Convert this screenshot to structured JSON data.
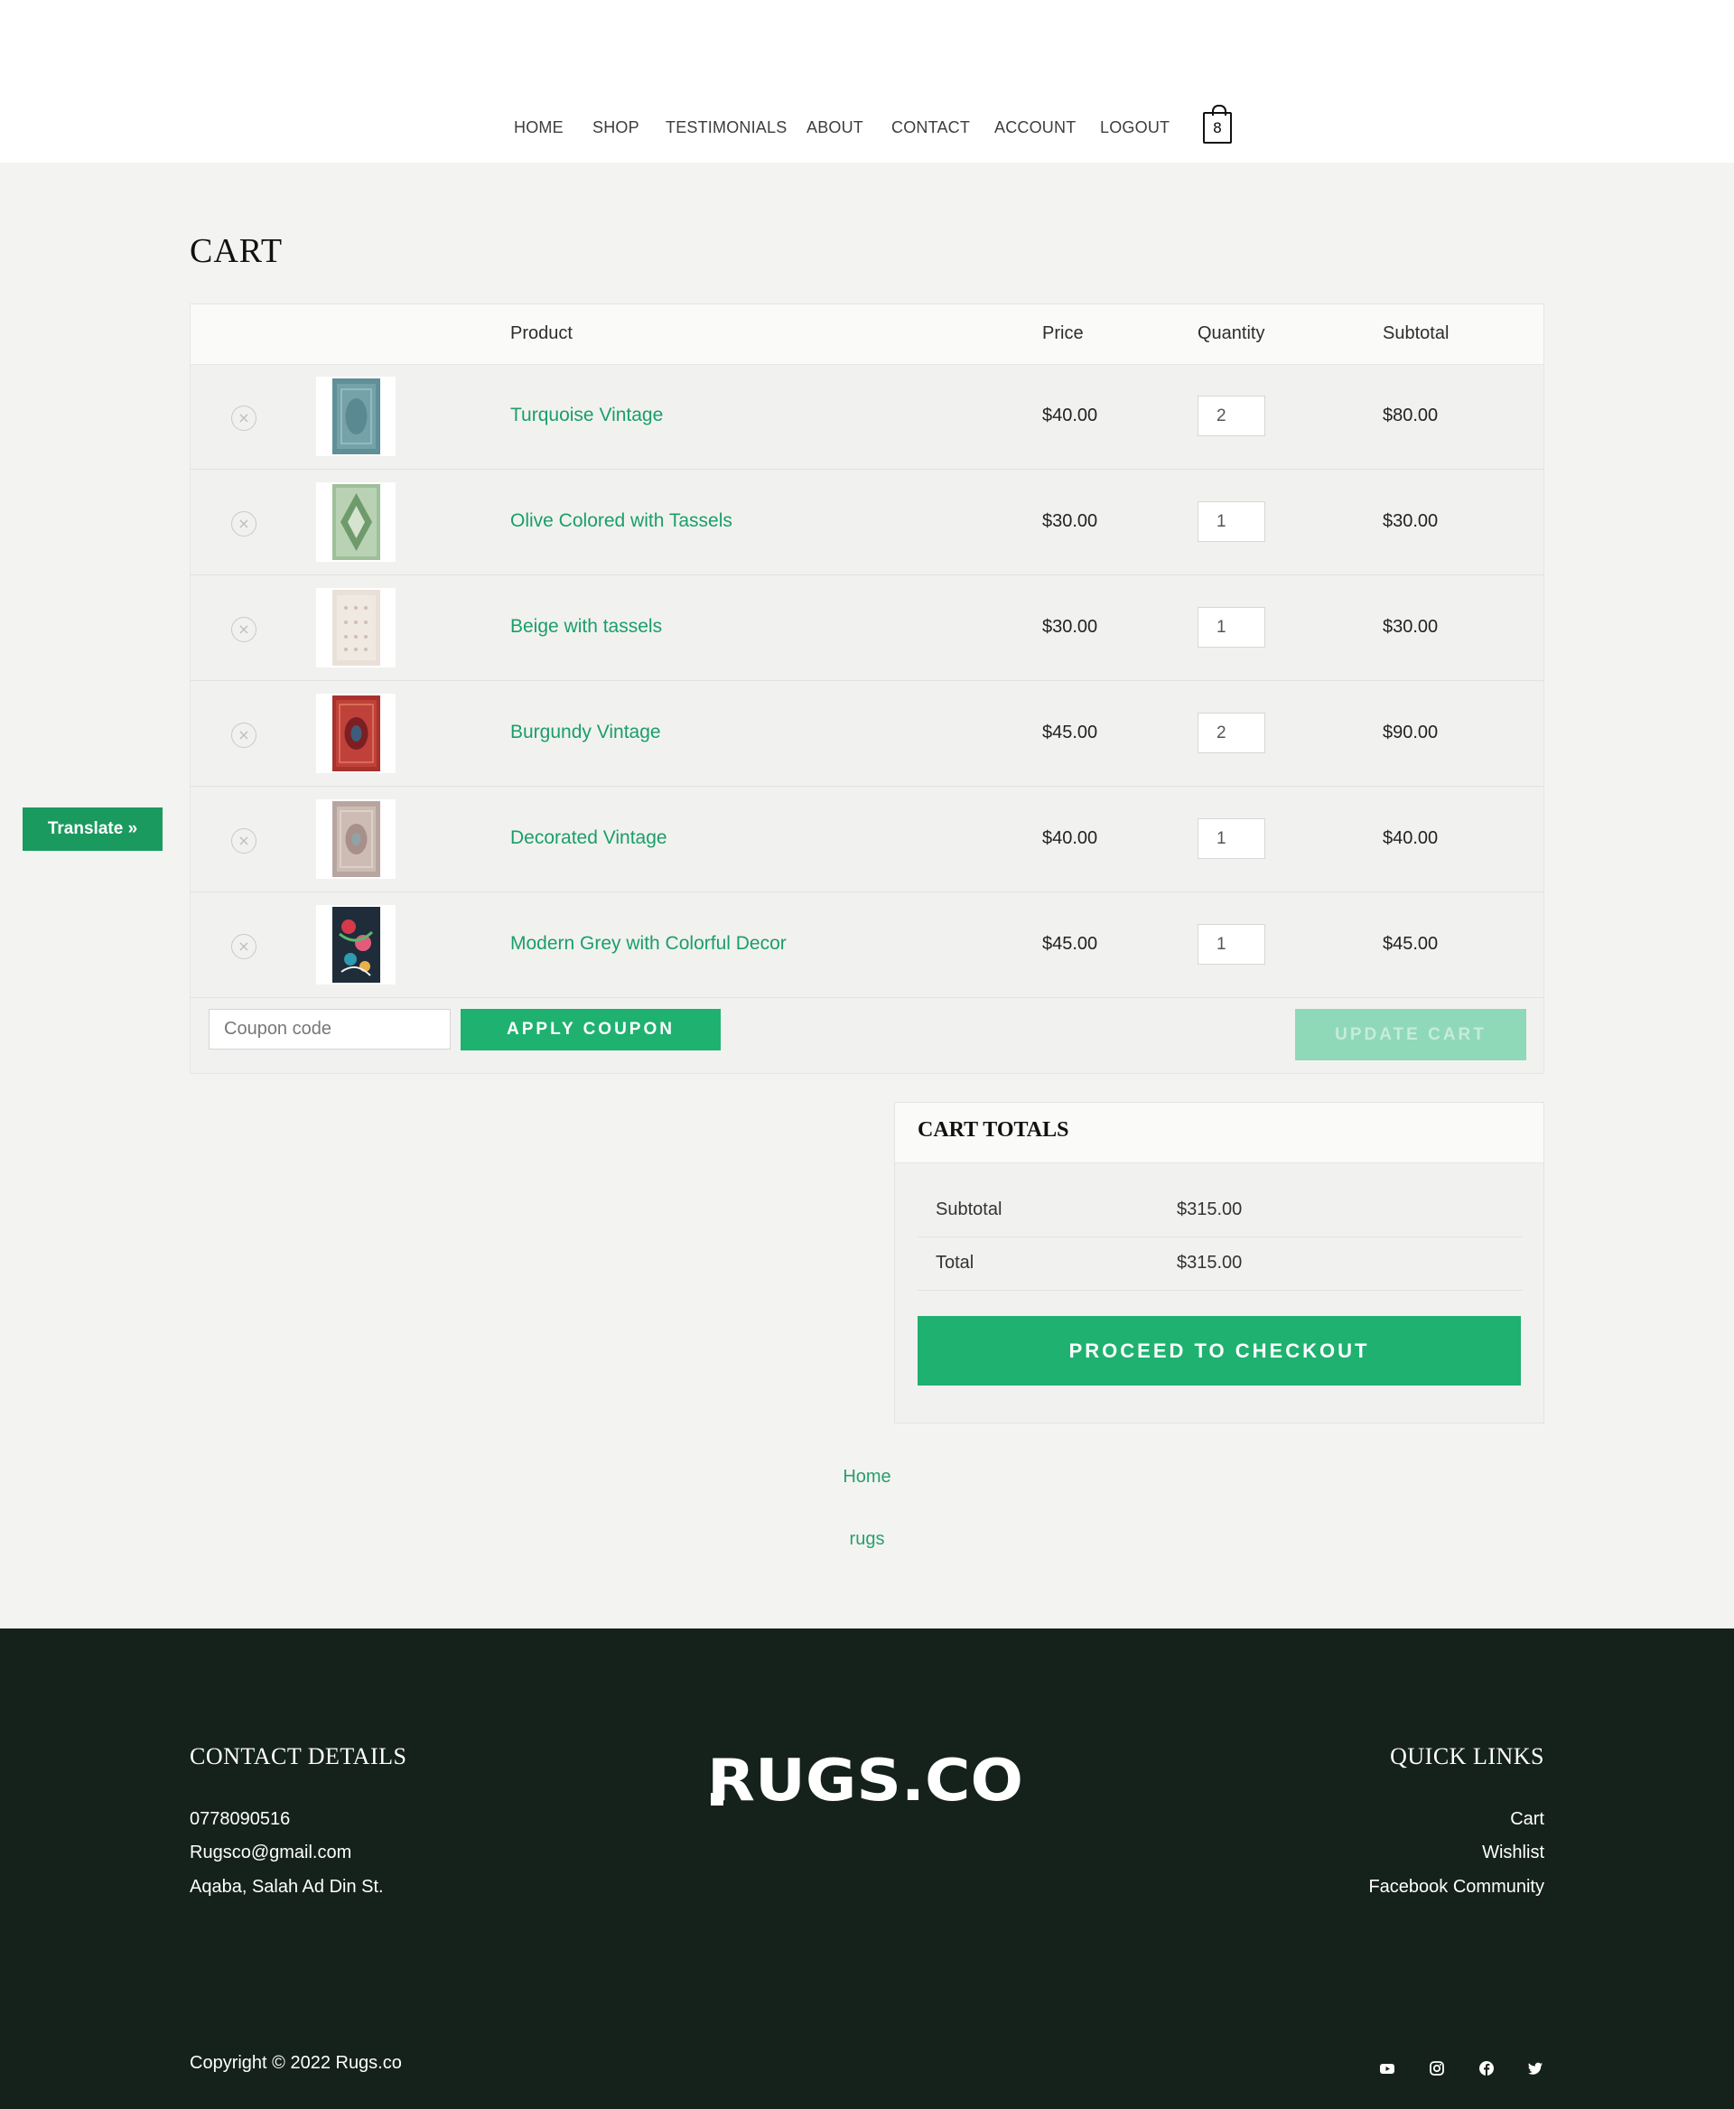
{
  "nav": {
    "items": [
      "HOME",
      "SHOP",
      "TESTIMONIALS",
      "ABOUT",
      "CONTACT",
      "ACCOUNT",
      "LOGOUT"
    ],
    "cart_count": "8"
  },
  "page_title": "CART",
  "table": {
    "headers": {
      "product": "Product",
      "price": "Price",
      "quantity": "Quantity",
      "subtotal": "Subtotal"
    },
    "rows": [
      {
        "name": "Turquoise Vintage",
        "price": "$40.00",
        "qty": "2",
        "subtotal": "$80.00",
        "remove": "×"
      },
      {
        "name": "Olive Colored with Tassels",
        "price": "$30.00",
        "qty": "1",
        "subtotal": "$30.00",
        "remove": "×"
      },
      {
        "name": "Beige with tassels",
        "price": "$30.00",
        "qty": "1",
        "subtotal": "$30.00",
        "remove": "×"
      },
      {
        "name": "Burgundy Vintage",
        "price": "$45.00",
        "qty": "2",
        "subtotal": "$90.00",
        "remove": "×"
      },
      {
        "name": "Decorated Vintage",
        "price": "$40.00",
        "qty": "1",
        "subtotal": "$40.00",
        "remove": "×"
      },
      {
        "name": "Modern Grey with Colorful Decor",
        "price": "$45.00",
        "qty": "1",
        "subtotal": "$45.00",
        "remove": "×"
      }
    ]
  },
  "coupon": {
    "placeholder": "Coupon code",
    "apply_label": "APPLY COUPON",
    "update_label": "UPDATE CART"
  },
  "totals": {
    "title": "CART TOTALS",
    "subtotal_label": "Subtotal",
    "subtotal_value": "$315.00",
    "total_label": "Total",
    "total_value": "$315.00",
    "checkout_label": "PROCEED TO CHECKOUT"
  },
  "bottom_links": [
    "Home",
    "rugs"
  ],
  "translate_label": "Translate »",
  "footer": {
    "contact_title": "CONTACT DETAILS",
    "phone": "0778090516",
    "email": "Rugsco@gmail.com",
    "address": "Aqaba, Salah Ad Din St.",
    "logo_text": "RUGS.CO",
    "quick_title": "QUICK LINKS",
    "quick_links": [
      "Cart",
      "Wishlist",
      "Facebook Community"
    ],
    "copyright": "Copyright © 2022 Rugs.co"
  },
  "icons": {
    "social": [
      "youtube-icon",
      "instagram-icon",
      "facebook-icon",
      "twitter-icon"
    ],
    "cart": "shopping-bag-icon",
    "remove": "close-circle-icon"
  },
  "colors": {
    "accent": "#1fb170",
    "link": "#1a9e6b",
    "footer_bg": "#15221b",
    "page_bg": "#f3f4f1"
  }
}
